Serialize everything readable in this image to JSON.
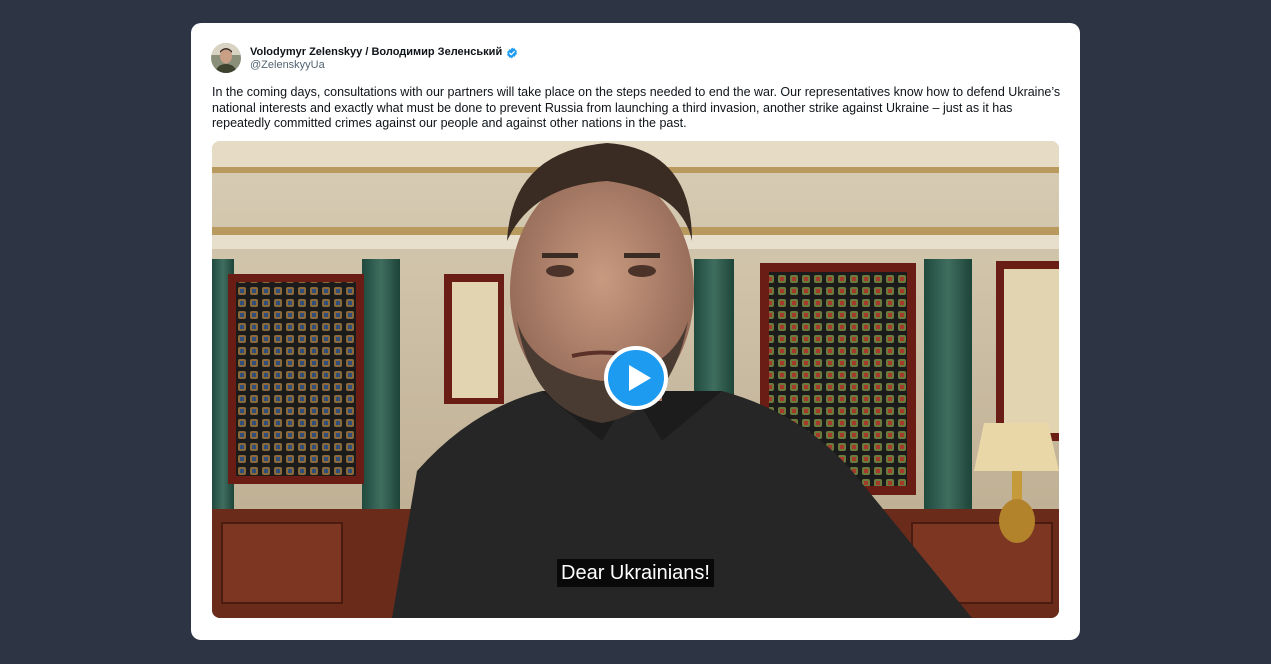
{
  "tweet": {
    "author_name": "Volodymyr Zelenskyy / Володимир Зеленський",
    "handle": "@ZelenskyyUa",
    "verified": true,
    "verified_color": "#1d9bf0",
    "text": "In the coming days, consultations with our partners will take place on the steps needed to end the war. Our representatives know how to defend Ukraine’s national interests and exactly what must be done to prevent Russia from launching a third invasion, another strike against Ukraine – just as it has repeatedly committed crimes against our people and against other nations in the past."
  },
  "video": {
    "caption": "Dear Ukrainians!",
    "play_icon": "play-icon",
    "play_button_color": "#1d9bf0"
  },
  "colors": {
    "page_background": "#2d3444",
    "card_background": "#ffffff"
  }
}
